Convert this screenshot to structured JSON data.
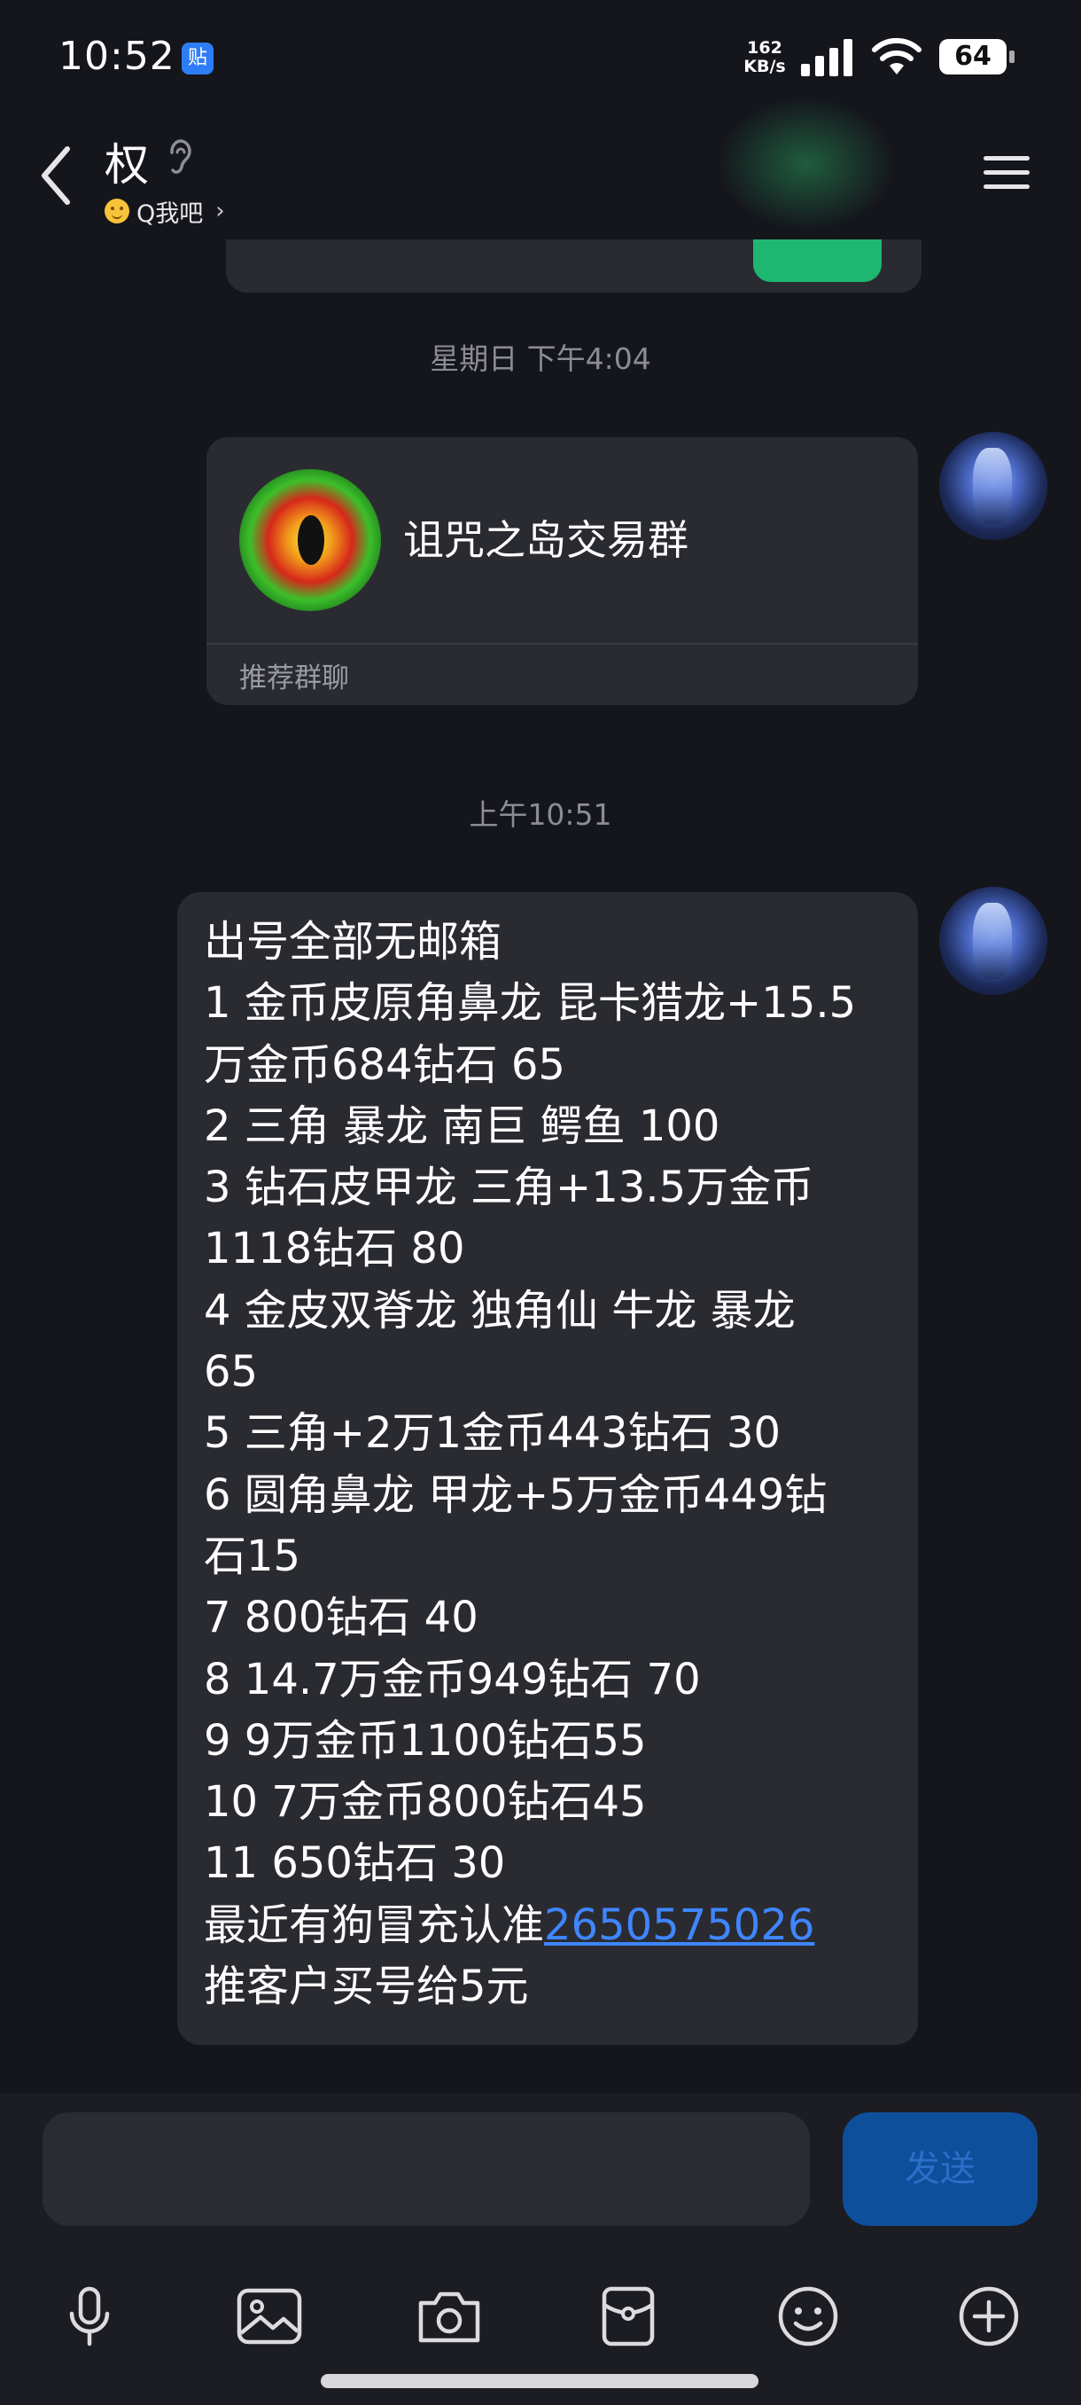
{
  "status_bar": {
    "time": "10:52",
    "notification_badge": "贴",
    "net_speed_value": "162",
    "net_speed_unit": "KB/s",
    "battery": "64",
    "signal_icon": "signal-bars-icon",
    "wifi_icon": "wifi-icon"
  },
  "header": {
    "title": "权",
    "subtitle": "Q我吧",
    "back_icon": "chevron-left-icon",
    "earpiece_icon": "ear-icon",
    "menu_icon": "hamburger-menu-icon"
  },
  "timestamps": {
    "first": "星期日 下午4:04",
    "second": "上午10:51"
  },
  "group_card": {
    "name": "诅咒之岛交易群",
    "label": "推荐群聊"
  },
  "message": {
    "lines": [
      "出号全部无邮箱",
      "1 金币皮原角鼻龙 昆卡猎龙+15.5",
      "万金币684钻石 65",
      "2 三角 暴龙 南巨 鳄鱼 100",
      "3 钻石皮甲龙 三角+13.5万金币",
      "1118钻石 80",
      "4 金皮双脊龙 独角仙 牛龙 暴龙",
      "65",
      "5 三角+2万1金币443钻石 30",
      "6 圆角鼻龙 甲龙+5万金币449钻",
      "石15",
      "7 800钻石 40",
      "8 14.7万金币949钻石 70",
      "9 9万金币1100钻石55",
      "10 7万金币800钻石45",
      "11 650钻石 30"
    ],
    "link_prefix": "最近有狗冒充认准",
    "link_text": "2650575026",
    "last_line": "推客户买号给5元"
  },
  "input": {
    "send_label": "发送"
  },
  "toolbar": {
    "icons": [
      "microphone-icon",
      "image-icon",
      "camera-icon",
      "red-packet-icon",
      "emoji-icon",
      "plus-icon"
    ]
  },
  "colors": {
    "background": "#15161c",
    "bubble": "#2a2b31",
    "link": "#3f86ff",
    "send_button": "#0e4f9c"
  }
}
